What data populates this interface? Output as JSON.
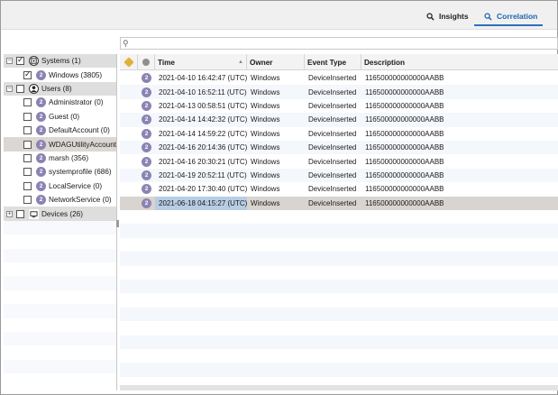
{
  "tabs": [
    {
      "label": "Insights",
      "icon": "search-icon",
      "active": false
    },
    {
      "label": "Correlation",
      "icon": "search-icon",
      "active": true
    }
  ],
  "search": {
    "placeholder": ""
  },
  "tree": [
    {
      "label": "Systems (1)",
      "kind": "group",
      "expander": "−",
      "checked": true,
      "icon": "systems-icon"
    },
    {
      "label": "Windows (3805)",
      "kind": "child",
      "checked": true,
      "badge": "2"
    },
    {
      "label": "Users (8)",
      "kind": "group",
      "expander": "−",
      "checked": false,
      "icon": "user-icon"
    },
    {
      "label": "Administrator (0)",
      "kind": "child",
      "checked": false,
      "badge": "2"
    },
    {
      "label": "Guest (0)",
      "kind": "child",
      "checked": false,
      "badge": "2"
    },
    {
      "label": "DefaultAccount (0)",
      "kind": "child",
      "checked": false,
      "badge": "2"
    },
    {
      "label": "WDAGUtilityAccount (",
      "kind": "child",
      "checked": false,
      "badge": "2",
      "selected": true
    },
    {
      "label": "marsh (356)",
      "kind": "child",
      "checked": false,
      "badge": "2"
    },
    {
      "label": "systemprofile (686)",
      "kind": "child",
      "checked": false,
      "badge": "2"
    },
    {
      "label": "LocalService (0)",
      "kind": "child",
      "checked": false,
      "badge": "2"
    },
    {
      "label": "NetworkService (0)",
      "kind": "child",
      "checked": false,
      "badge": "2"
    },
    {
      "label": "Devices (26)",
      "kind": "group",
      "expander": "+",
      "checked": false,
      "icon": "devices-icon"
    }
  ],
  "grid": {
    "columns": {
      "tag": "",
      "status": "",
      "time": "Time",
      "owner": "Owner",
      "event_type": "Event Type",
      "description": "Description"
    },
    "sort_column": "Time",
    "rows": [
      {
        "badge": "2",
        "time": "2021-04-10 16:42:47 (UTC)",
        "owner": "Windows",
        "event_type": "DeviceInserted",
        "description": "116500000000000AABB"
      },
      {
        "badge": "2",
        "time": "2021-04-10 16:52:11 (UTC)",
        "owner": "Windows",
        "event_type": "DeviceInserted",
        "description": "116500000000000AABB"
      },
      {
        "badge": "2",
        "time": "2021-04-13 00:58:51 (UTC)",
        "owner": "Windows",
        "event_type": "DeviceInserted",
        "description": "116500000000000AABB"
      },
      {
        "badge": "2",
        "time": "2021-04-14 14:42:32 (UTC)",
        "owner": "Windows",
        "event_type": "DeviceInserted",
        "description": "116500000000000AABB"
      },
      {
        "badge": "2",
        "time": "2021-04-14 14:59:22 (UTC)",
        "owner": "Windows",
        "event_type": "DeviceInserted",
        "description": "116500000000000AABB"
      },
      {
        "badge": "2",
        "time": "2021-04-16 20:14:36 (UTC)",
        "owner": "Windows",
        "event_type": "DeviceInserted",
        "description": "116500000000000AABB"
      },
      {
        "badge": "2",
        "time": "2021-04-16 20:30:21 (UTC)",
        "owner": "Windows",
        "event_type": "DeviceInserted",
        "description": "116500000000000AABB"
      },
      {
        "badge": "2",
        "time": "2021-04-19 20:52:11 (UTC)",
        "owner": "Windows",
        "event_type": "DeviceInserted",
        "description": "116500000000000AABB"
      },
      {
        "badge": "2",
        "time": "2021-04-20 17:30:40 (UTC)",
        "owner": "Windows",
        "event_type": "DeviceInserted",
        "description": "116500000000000AABB"
      },
      {
        "badge": "2",
        "time": "2021-06-18 04:15:27 (UTC)",
        "owner": "Windows",
        "event_type": "DeviceInserted",
        "description": "116500000000000AABB",
        "selected": true
      }
    ]
  },
  "colors": {
    "accent": "#2b6fc0",
    "badge": "#8b83b4",
    "selected_row": "#d9d4cf",
    "selected_cell": "#b8cde4"
  }
}
